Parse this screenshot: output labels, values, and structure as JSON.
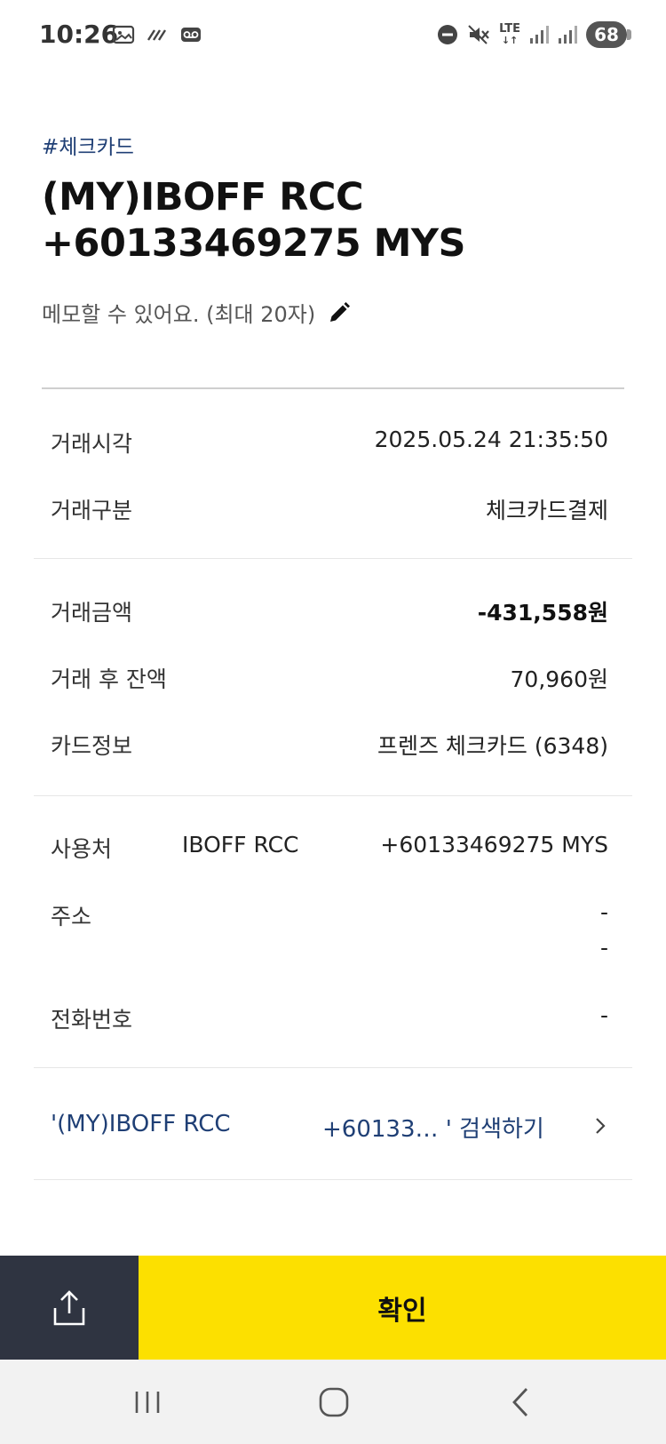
{
  "status_bar": {
    "time": "10:26",
    "network": "LTE",
    "battery": "68",
    "icons": [
      "gallery-icon",
      "wifi-calling-icon",
      "voicemail-icon",
      "dnd-icon",
      "mute-icon",
      "signal-icon"
    ]
  },
  "header": {
    "tag": "#체크카드",
    "title_line1": "(MY)IBOFF RCC",
    "title_line2": "+60133469275  MYS",
    "memo_placeholder": "메모할 수 있어요. (최대 20자)"
  },
  "details": {
    "time_label": "거래시각",
    "time_value": "2025.05.24 21:35:50",
    "type_label": "거래구분",
    "type_value": "체크카드결제",
    "amount_label": "거래금액",
    "amount_value": "-431,558원",
    "balance_label": "거래 후 잔액",
    "balance_value": "70,960원",
    "card_label": "카드정보",
    "card_value": "프렌즈 체크카드 (6348)",
    "merchant_label": "사용처",
    "merchant_name": "IBOFF RCC",
    "merchant_value": "+60133469275  MYS",
    "address_label": "주소",
    "address_value1": "-",
    "address_value2": "-",
    "phone_label": "전화번호",
    "phone_value": "-"
  },
  "search": {
    "left_text": "'(MY)IBOFF RCC",
    "right_text": "+60133…  ' 검색하기"
  },
  "buttons": {
    "confirm": "확인"
  },
  "colors": {
    "accent_yellow": "#fce000",
    "share_bg": "#2f3441",
    "link_blue": "#1f3f75"
  }
}
